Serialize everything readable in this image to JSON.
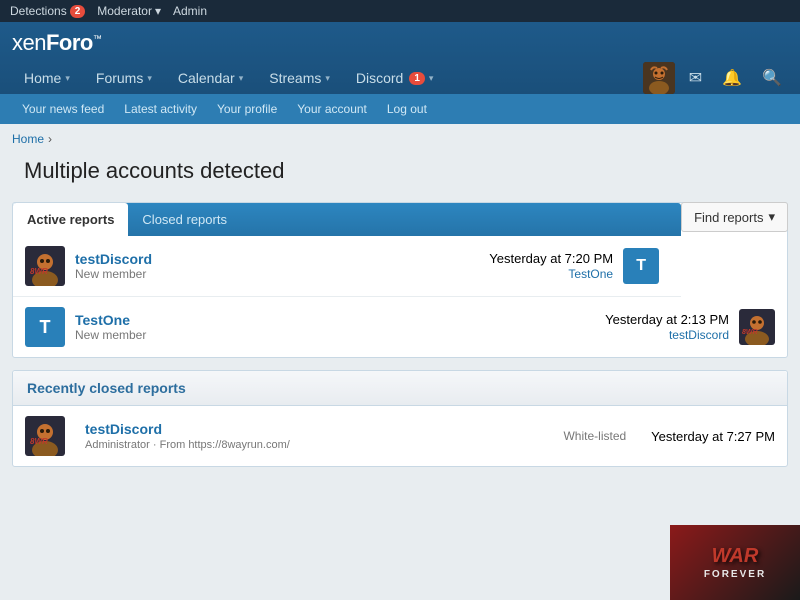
{
  "adminBar": {
    "detections": "Detections",
    "detections_count": "2",
    "moderator": "Moderator",
    "admin": "Admin"
  },
  "header": {
    "logo_xen": "xen",
    "logo_foro": "Foro",
    "logo_tm": "™"
  },
  "nav": {
    "items": [
      {
        "label": "Home",
        "hasArrow": true
      },
      {
        "label": "Forums",
        "hasArrow": true
      },
      {
        "label": "Calendar",
        "hasArrow": true
      },
      {
        "label": "Streams",
        "hasArrow": true
      },
      {
        "label": "Discord",
        "hasArrow": true,
        "badge": "1"
      }
    ]
  },
  "subNav": {
    "items": [
      {
        "label": "Your news feed"
      },
      {
        "label": "Latest activity"
      },
      {
        "label": "Your profile"
      },
      {
        "label": "Your account"
      },
      {
        "label": "Log out"
      }
    ]
  },
  "breadcrumb": {
    "home": "Home"
  },
  "pageTitle": "Multiple accounts detected",
  "findReports": "Find reports",
  "tabs": {
    "active": "Active reports",
    "closed": "Closed reports"
  },
  "activeReports": [
    {
      "username": "testDiscord",
      "role": "New member",
      "time": "Yesterday at 7:20 PM",
      "related_user": "TestOne",
      "avatar_type": "img"
    },
    {
      "username": "TestOne",
      "role": "New member",
      "time": "Yesterday at 2:13 PM",
      "related_user": "testDiscord",
      "avatar_type": "T"
    }
  ],
  "recentlyClosed": {
    "header": "Recently closed reports",
    "items": [
      {
        "username": "testDiscord",
        "role": "Administrator",
        "meta": "From https://8wayrun.com/",
        "status": "White-listed",
        "time": "Yesterday at 7:27 PM",
        "avatar_type": "img"
      }
    ]
  },
  "warForever": {
    "line1": "WAR",
    "line2": "FOREVER"
  }
}
